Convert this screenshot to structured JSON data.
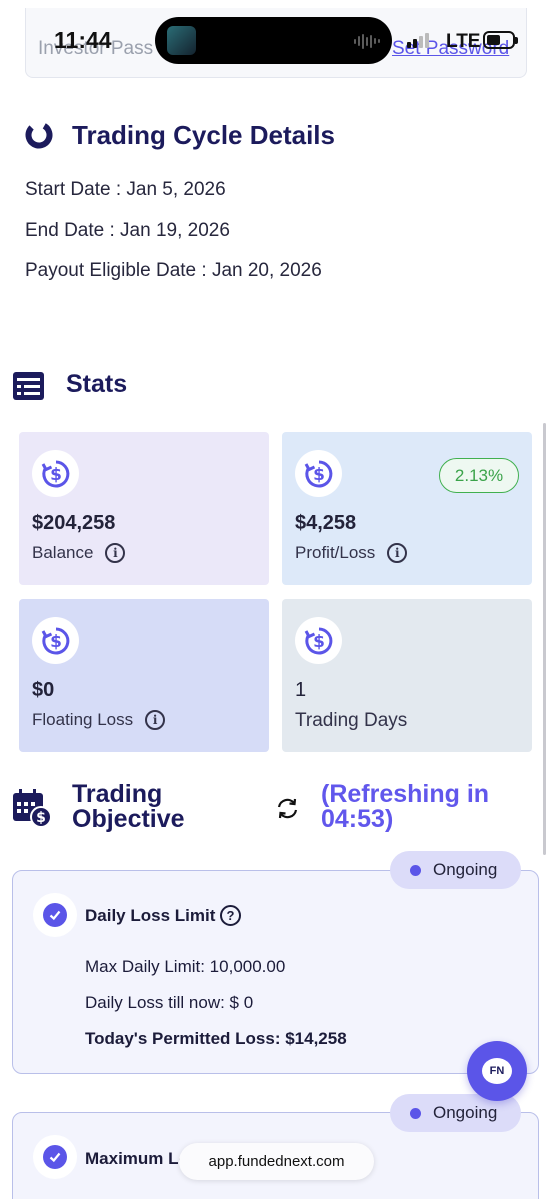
{
  "status_bar": {
    "time": "11:44",
    "network": "LTE"
  },
  "account": {
    "investor_pass_label": "Investor Pass",
    "set_password": "Set Password"
  },
  "cycle": {
    "title": "Trading Cycle Details",
    "start": "Start Date : Jan 5, 2026",
    "end": "End Date : Jan 19, 2026",
    "payout": "Payout Eligible Date : Jan 20, 2026"
  },
  "stats": {
    "title": "Stats",
    "balance": {
      "value": "$204,258",
      "label": "Balance"
    },
    "profit": {
      "value": "$4,258",
      "label": "Profit/Loss",
      "pct": "2.13%"
    },
    "floating": {
      "value": "$0",
      "label": "Floating Loss"
    },
    "days": {
      "value": "1",
      "label": "Trading Days"
    }
  },
  "objective": {
    "title": "Trading Objective",
    "refreshing": "(Refreshing in 04:53)",
    "daily": {
      "status": "Ongoing",
      "name": "Daily Loss Limit",
      "max_daily": "Max Daily Limit: 10,000.00",
      "loss_now": "Daily Loss till now: $ 0",
      "permitted": "Today's Permitted Loss: $14,258"
    },
    "maximum": {
      "status": "Ongoing",
      "name": "Maximum Loss Limit"
    }
  },
  "chat_label": "FN",
  "browser": {
    "url": "app.fundednext.com"
  },
  "colors": {
    "accent": "#5b55e8",
    "navy": "#1c1b5c",
    "green": "#3ba34a"
  },
  "icons": [
    "cycle-icon",
    "stats-icon",
    "dollar-refresh-icon",
    "info-icon",
    "calendar-dollar-icon",
    "refresh-icon",
    "check-icon",
    "help-icon",
    "chat-icon"
  ]
}
